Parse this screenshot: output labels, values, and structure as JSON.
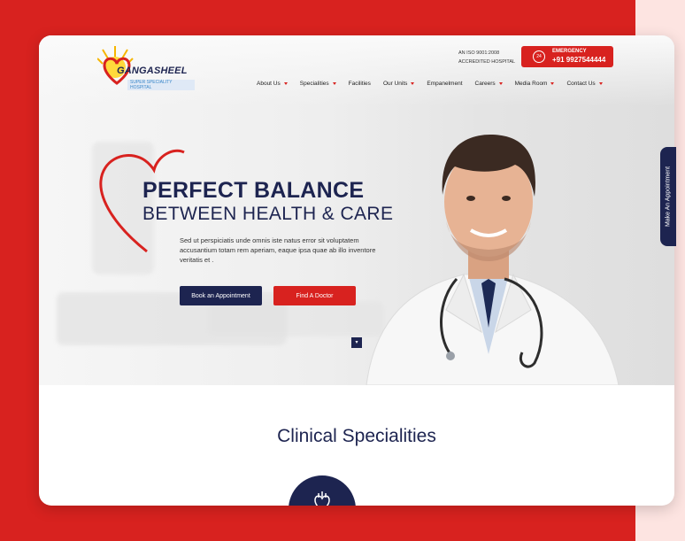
{
  "brand": {
    "name": "GANGASHEEL",
    "tagline": "SUPER SPECIALITY HOSPITAL"
  },
  "iso": {
    "line1": "AN ISO 9001:2008",
    "line2": "ACCREDITED HOSPITAL"
  },
  "emergency": {
    "icon_text": "24",
    "label": "EMERGENCY",
    "phone": "+91 9927544444"
  },
  "nav": [
    {
      "label": "About Us",
      "dropdown": true
    },
    {
      "label": "Specialities",
      "dropdown": true
    },
    {
      "label": "Facilities",
      "dropdown": false
    },
    {
      "label": "Our Units",
      "dropdown": true
    },
    {
      "label": "Empanelment",
      "dropdown": false
    },
    {
      "label": "Careers",
      "dropdown": true
    },
    {
      "label": "Media Room",
      "dropdown": true
    },
    {
      "label": "Contact Us",
      "dropdown": true
    }
  ],
  "hero": {
    "headline": "PERFECT BALANCE",
    "subhead": "BETWEEN HEALTH & CARE",
    "paragraph": "Sed ut perspiciatis unde omnis iste natus error sit voluptatem accusantium totam rem aperiam, eaque ipsa quae ab illo inventore veritatis et .",
    "book_button": "Book an Appointment",
    "find_button": "Find A Doctor"
  },
  "side_tab": {
    "label": "Make An Appointment"
  },
  "sections": {
    "clinical_title": "Clinical Specialities"
  },
  "colors": {
    "brand_red": "#d8221f",
    "navy": "#1d2450"
  }
}
